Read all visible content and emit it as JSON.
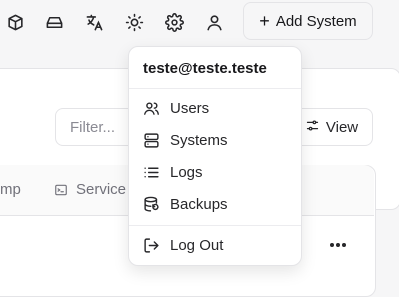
{
  "topbar": {
    "icons": [
      "package-icon",
      "hard-drive-icon",
      "languages-icon",
      "theme-sun-icon",
      "settings-gear-icon",
      "user-icon"
    ],
    "add_system_label": "Add System"
  },
  "toolbar": {
    "filter_placeholder": "Filter...",
    "view_label": "View"
  },
  "table": {
    "columns": [
      "mp",
      "Service"
    ]
  },
  "user_menu": {
    "email": "teste@teste.teste",
    "items": [
      {
        "label": "Users",
        "icon": "users-icon"
      },
      {
        "label": "Systems",
        "icon": "server-icon"
      },
      {
        "label": "Logs",
        "icon": "list-icon"
      },
      {
        "label": "Backups",
        "icon": "database-backup-icon"
      }
    ],
    "logout_label": "Log Out"
  }
}
